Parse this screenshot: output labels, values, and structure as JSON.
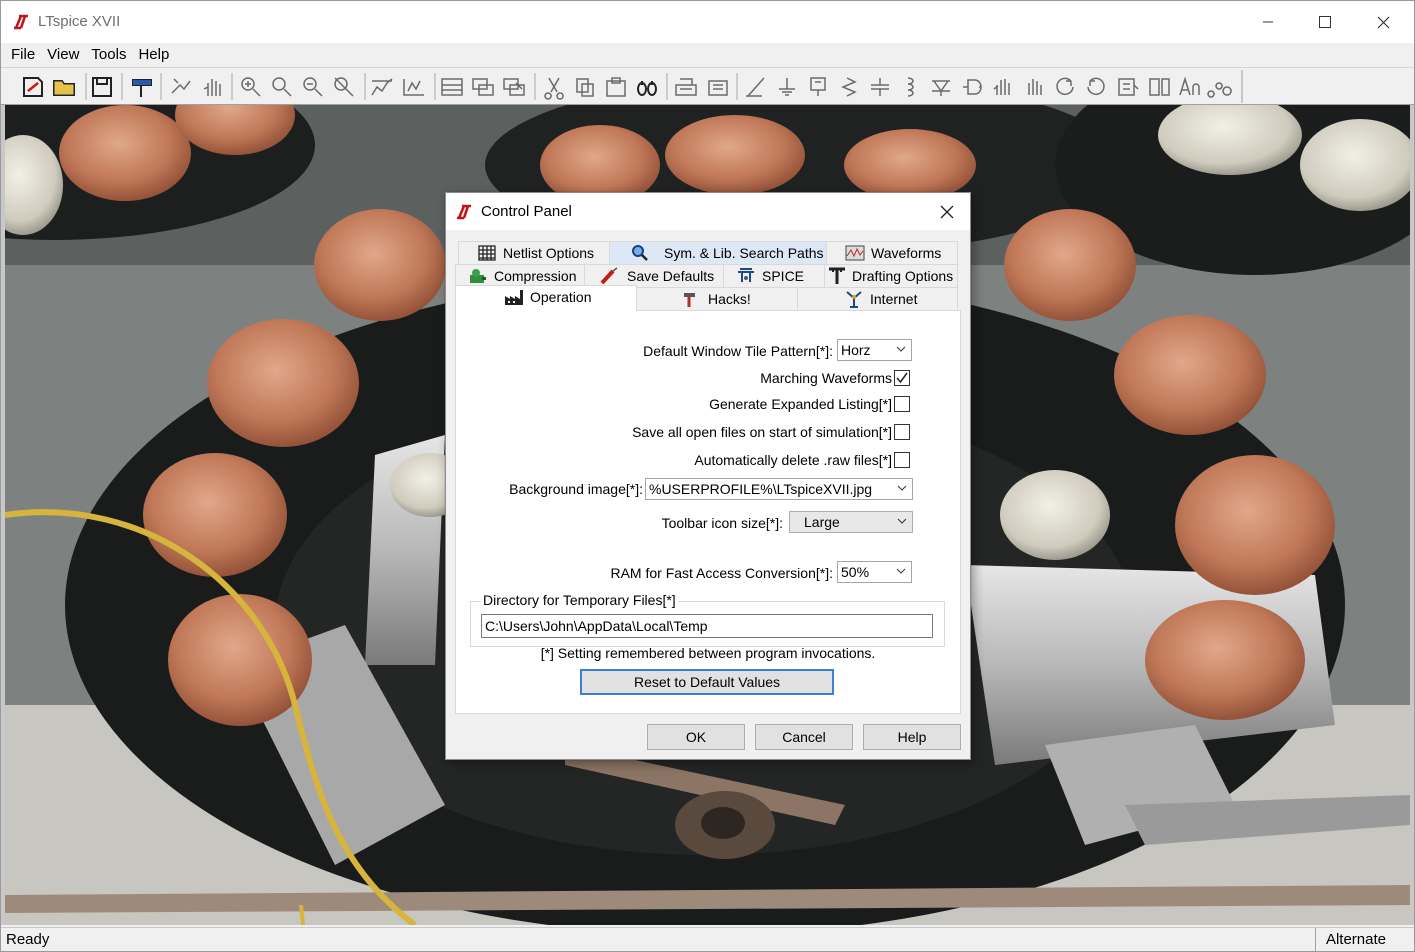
{
  "app": {
    "title": "LTspice XVII",
    "menu": [
      "File",
      "View",
      "Tools",
      "Help"
    ],
    "status_left": "Ready",
    "status_right": "Alternate"
  },
  "toolbar": {
    "icons": [
      "new-schematic-icon",
      "open-icon",
      "save-icon",
      "control-panel-hammer-icon",
      "run-icon",
      "halt-hand-icon",
      "zoom-in-icon",
      "zoom-area-icon",
      "zoom-out-icon",
      "zoom-fit-icon",
      "autorange-icon",
      "tile-vertical-icon",
      "tile-horizontal-icon",
      "cascade-icon",
      "close-window-icon",
      "cut-icon",
      "copy-icon",
      "paste-icon",
      "find-icon",
      "print-icon",
      "print-preview-icon",
      "draw-wire-icon",
      "ground-icon",
      "label-net-icon",
      "resistor-icon",
      "capacitor-icon",
      "inductor-icon",
      "diode-icon",
      "component-icon",
      "move-icon",
      "drag-icon",
      "undo-icon",
      "redo-icon",
      "rotate-icon",
      "mirror-icon",
      "text-icon",
      "spice-directive-icon"
    ]
  },
  "dialog": {
    "title": "Control Panel",
    "tabs_row1": [
      "Netlist Options",
      "Sym. & Lib. Search Paths",
      "Waveforms"
    ],
    "tabs_row2": [
      "Compression",
      "Save Defaults",
      "SPICE",
      "Drafting Options"
    ],
    "tabs_row3": [
      "Operation",
      "Hacks!",
      "Internet"
    ],
    "fields": {
      "tile_pattern_label": "Default Window Tile Pattern[*]:",
      "tile_pattern_value": "Horz",
      "marching_label": "Marching Waveforms",
      "marching_checked": true,
      "expanded_listing_label": "Generate Expanded Listing[*]",
      "expanded_listing_checked": false,
      "save_open_label": "Save all open files on start of simulation[*]",
      "save_open_checked": false,
      "delete_raw_label": "Automatically delete .raw files[*]",
      "delete_raw_checked": false,
      "bg_image_label": "Background image[*]:",
      "bg_image_value": "%USERPROFILE%\\LTspiceXVII.jpg",
      "icon_size_label": "Toolbar icon size[*]:",
      "icon_size_value": "Large",
      "ram_label": "RAM for Fast Access Conversion[*]:",
      "ram_value": "50%",
      "tmpdir_group_label": "Directory for Temporary Files[*]",
      "tmpdir_value": "C:\\Users\\John\\AppData\\Local\\Temp"
    },
    "note": "[*] Setting remembered between program invocations.",
    "reset_label": "Reset to Default Values",
    "buttons": {
      "ok": "OK",
      "cancel": "Cancel",
      "help": "Help"
    }
  }
}
